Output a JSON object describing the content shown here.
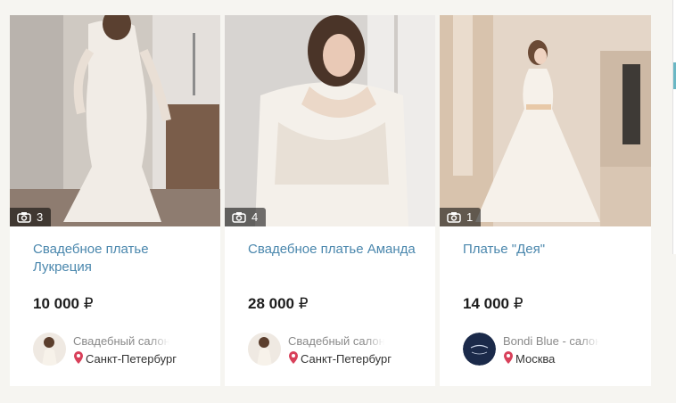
{
  "listings": [
    {
      "title": "Свадебное платье Лукреция",
      "price": "10 000",
      "currency": "₽",
      "photo_count": "3",
      "seller_name": "Свадебный салон \"Ле",
      "city": "Санкт-Петербург"
    },
    {
      "title": "Свадебное платье Аманда",
      "price": "28 000",
      "currency": "₽",
      "photo_count": "4",
      "seller_name": "Свадебный салон \"Ле",
      "city": "Санкт-Петербург"
    },
    {
      "title": "Платье \"Дея\"",
      "price": "14 000",
      "currency": "₽",
      "photo_count": "1",
      "seller_name": "Bondi Blue - салон св",
      "city": "Москва"
    }
  ],
  "icons": {
    "camera": "camera-icon",
    "location": "location-pin-icon"
  },
  "colors": {
    "title": "#4a87ad",
    "pin": "#d8405a",
    "background": "#f6f5f1"
  }
}
